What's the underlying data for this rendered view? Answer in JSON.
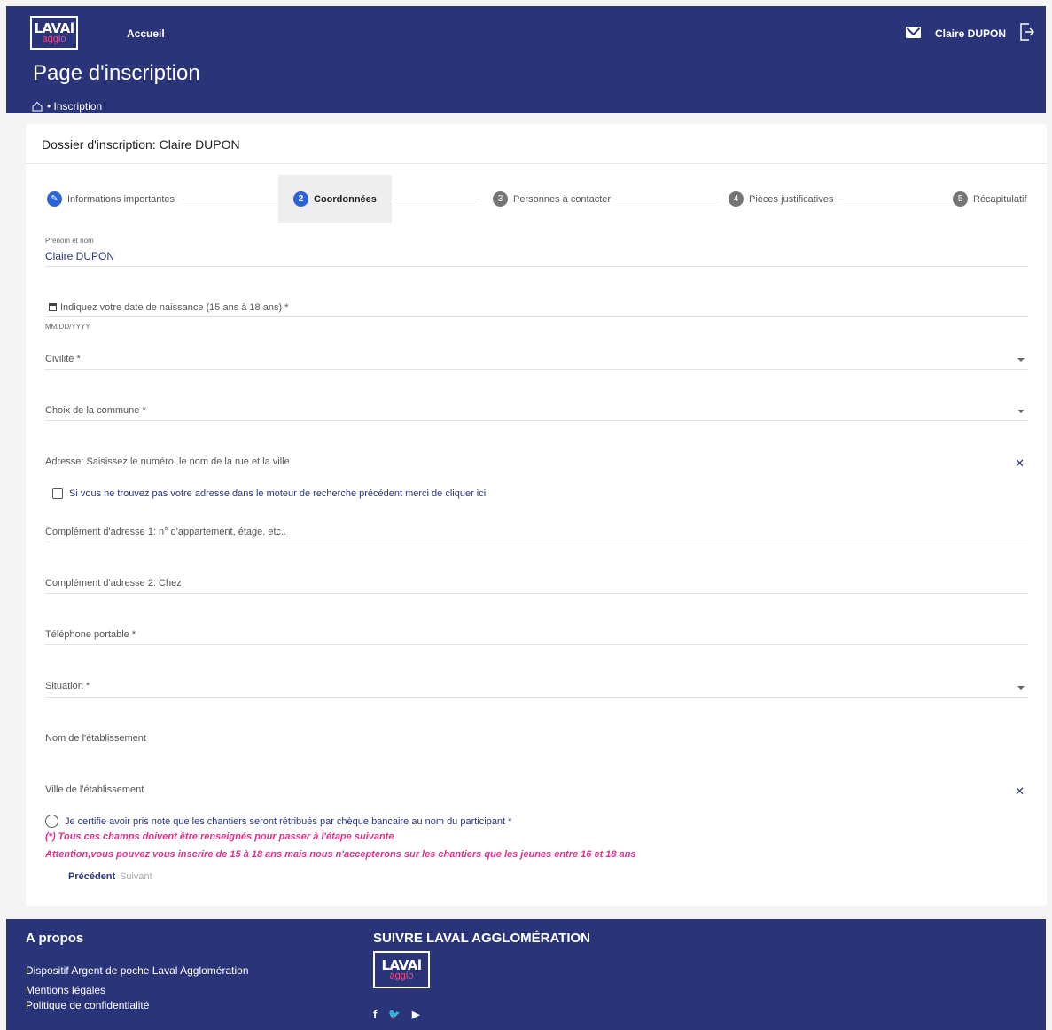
{
  "header": {
    "logo_top": "LAVAl",
    "logo_bottom": "agglo",
    "nav_home": "Accueil",
    "user_name": "Claire DUPON",
    "page_title": "Page d'inscription",
    "breadcrumb_current": "• Inscription"
  },
  "card": {
    "title": "Dossier d'inscription: Claire DUPON"
  },
  "stepper": {
    "steps": [
      {
        "num": "✎",
        "label": "Informations importantes"
      },
      {
        "num": "2",
        "label": "Coordonnées"
      },
      {
        "num": "3",
        "label": "Personnes à contacter"
      },
      {
        "num": "4",
        "label": "Pièces justificatives"
      },
      {
        "num": "5",
        "label": "Récapitulatif"
      }
    ]
  },
  "form": {
    "name_label": "Prénom et nom",
    "name_value": "Claire DUPON",
    "birthdate_label": "Indiquez votre date de naissance (15 ans à 18 ans) *",
    "birthdate_hint": "MM/DD/YYYY",
    "civility_label": "Civilité *",
    "commune_label": "Choix de la commune *",
    "address_label": "Adresse: Saisissez le numéro, le nom de la rue et la ville",
    "address_checkbox_label": "Si vous ne trouvez pas votre adresse dans le moteur de recherche précédent merci de cliquer ici",
    "complement1_label": "Complément d'adresse 1: n° d'appartement, étage, etc..",
    "complement2_label": "Complément d'adresse 2: Chez",
    "phone_label": "Téléphone portable *",
    "situation_label": "Situation *",
    "school_name_label": "Nom de l'établissement",
    "school_city_label": "Ville de l'établissement",
    "certify_label": "Je certifie avoir pris note que les chantiers seront rétribués par chèque bancaire au nom du participant *",
    "note_required": "(*) Tous ces champs doivent être renseignés pour passer à l'étape suivante",
    "note_age": "Attention,vous pouvez vous inscrire de 15 à 18 ans mais nous n'accepterons sur les chantiers que les jeunes entre 16 et 18 ans",
    "prev_button": "Précédent",
    "next_button": "Suivant"
  },
  "footer": {
    "about_title": "A propos",
    "links": [
      "Dispositif Argent de poche Laval Agglomération",
      "Mentions légales",
      "Politique de confidentialité"
    ],
    "follow_title": "SUIVRE LAVAL AGGLOMÉRATION",
    "logo_top": "LAVAl",
    "logo_bottom": "agglo",
    "social": [
      "f",
      "🐦",
      "▶"
    ]
  },
  "colors": {
    "primary": "#2a3479",
    "accent": "#2c63d6",
    "note": "#e0318a"
  }
}
